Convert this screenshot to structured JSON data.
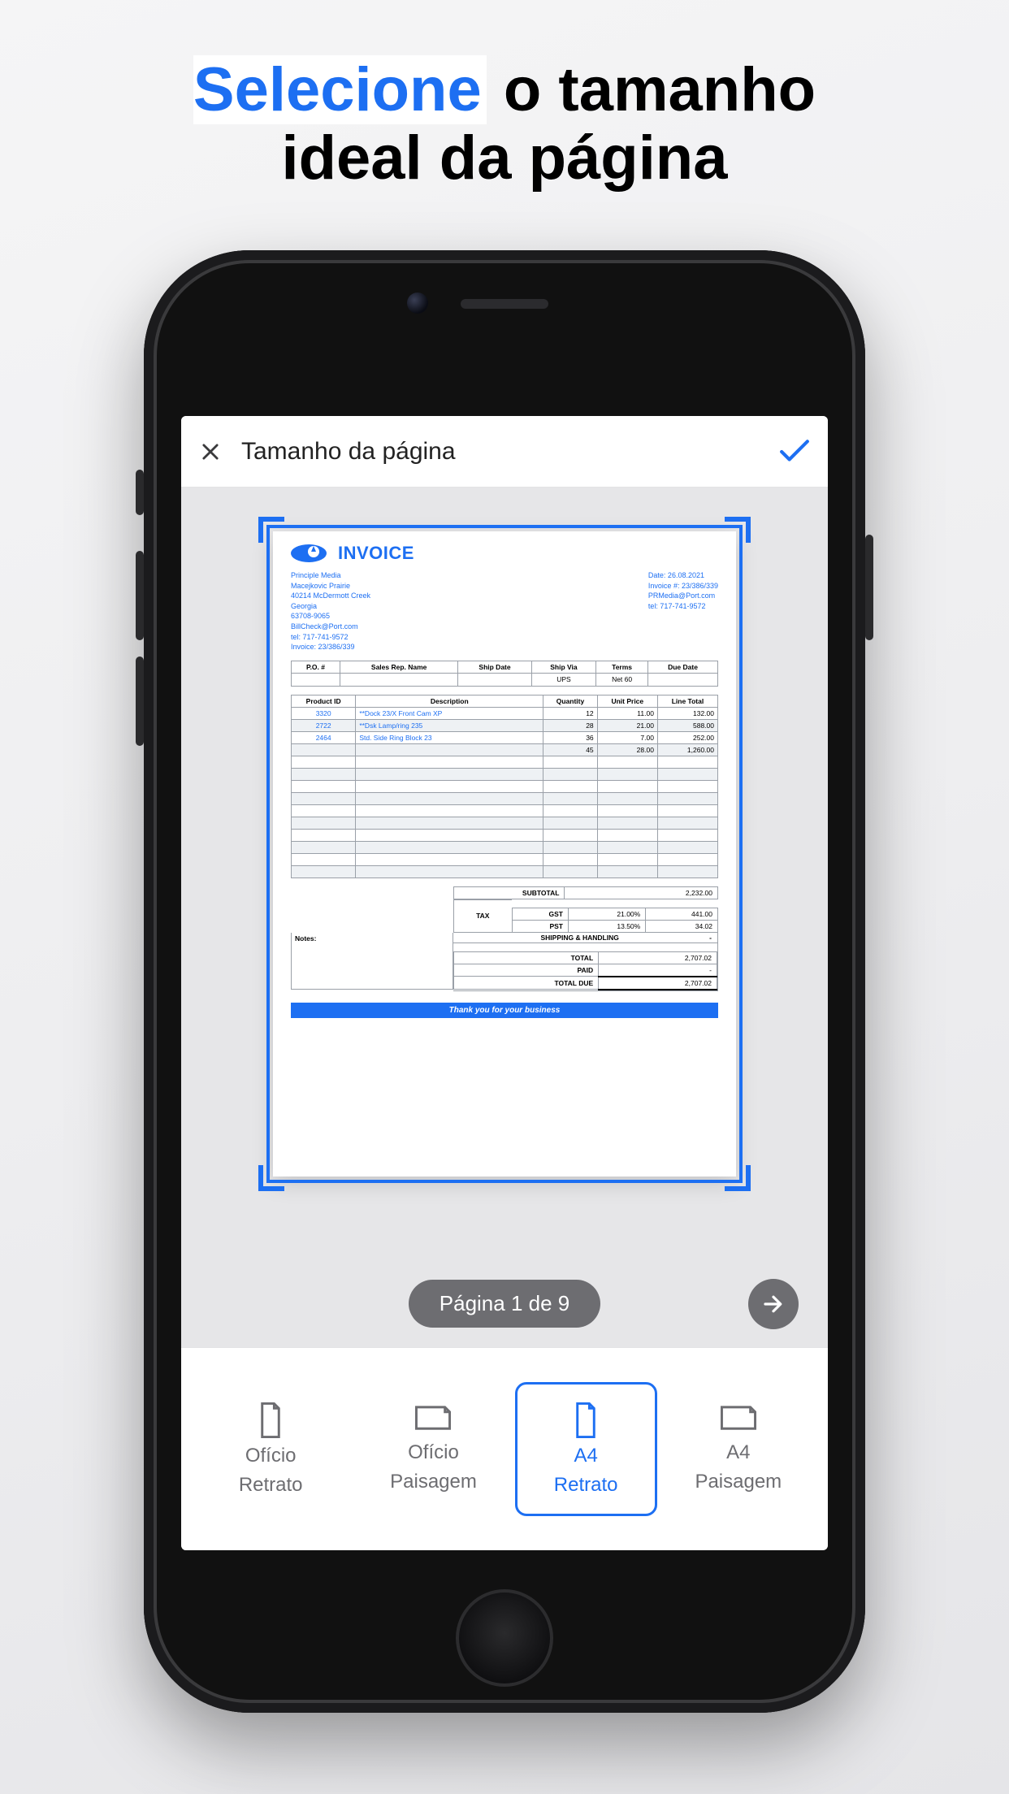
{
  "headline": {
    "word1": "Selecione",
    "rest1": " o tamanho",
    "line2": "ideal da página"
  },
  "header": {
    "title": "Tamanho da página"
  },
  "pager": {
    "label": "Página 1 de 9"
  },
  "options": [
    {
      "l1": "Ofício",
      "l2": "Retrato"
    },
    {
      "l1": "Ofício",
      "l2": "Paisagem"
    },
    {
      "l1": "A4",
      "l2": "Retrato"
    },
    {
      "l1": "A4",
      "l2": "Paisagem"
    }
  ],
  "invoice": {
    "title": "INVOICE",
    "from": [
      "Principle Media",
      "Macejkovic Prairie",
      "40214 McDermott Creek",
      "Georgia",
      "63708-9065",
      "BillCheck@Port.com",
      "tel: 717-741-9572",
      "Invoice: 23/386/339"
    ],
    "to": [
      "Date: 26.08.2021",
      "Invoice #: 23/386/339",
      "PRMedia@Port.com",
      "tel: 717-741-9572"
    ],
    "t1_head": [
      "P.O. #",
      "Sales Rep. Name",
      "Ship Date",
      "Ship Via",
      "Terms",
      "Due Date"
    ],
    "t1_row": [
      "",
      "",
      "",
      "UPS",
      "Net 60",
      ""
    ],
    "t2_head": [
      "Product ID",
      "Description",
      "Quantity",
      "Unit Price",
      "Line Total"
    ],
    "t2_rows": [
      [
        "3320",
        "**Dock 23/X Front Cam XP",
        "12",
        "11.00",
        "132.00"
      ],
      [
        "2722",
        "**Dsk Lamp/ring 235",
        "28",
        "21.00",
        "588.00"
      ],
      [
        "2464",
        "Std. Side Ring Block 23",
        "36",
        "7.00",
        "252.00"
      ],
      [
        "",
        "",
        "45",
        "28.00",
        "1,260.00"
      ]
    ],
    "subtotal_label": "SUBTOTAL",
    "subtotal": "2,232.00",
    "tax_label": "TAX",
    "gst_label": "GST",
    "gst_rate": "21.00%",
    "gst_val": "441.00",
    "pst_label": "PST",
    "pst_rate": "13.50%",
    "pst_val": "34.02",
    "notes": "Notes:",
    "ship": "SHIPPING & HANDLING",
    "ship_val": "-",
    "total_label": "TOTAL",
    "total": "2,707.02",
    "paid_label": "PAID",
    "paid": "-",
    "due_label": "TOTAL DUE",
    "due": "2,707.02",
    "thank": "Thank you for your business"
  }
}
